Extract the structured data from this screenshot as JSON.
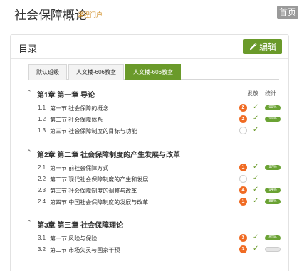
{
  "header": {
    "title": "社会保障概论",
    "portal_link": "课程门户",
    "home_label": "首页"
  },
  "card": {
    "title": "目录",
    "edit_label": "编辑"
  },
  "tabs": [
    {
      "label": "默认班级",
      "active": false
    },
    {
      "label": "人文楼-606教室",
      "active": false
    },
    {
      "label": "人文楼-606教室",
      "active": true
    }
  ],
  "columns": {
    "publish": "发放",
    "stats": "统计"
  },
  "chapters": [
    {
      "title": "第1章 第一章 导论",
      "lessons": [
        {
          "num": "1.1",
          "name": "第一节 社会保障的概念",
          "count": "2",
          "progress": "99%"
        },
        {
          "num": "1.2",
          "name": "第二节 社会保障体系",
          "count": "2",
          "progress": "99%"
        },
        {
          "num": "1.3",
          "name": "第三节 社会保障制度的目标与功能",
          "count": "",
          "progress": ""
        }
      ]
    },
    {
      "title": "第2章 第二章 社会保障制度的产生发展与改革",
      "lessons": [
        {
          "num": "2.1",
          "name": "第一节 前社会保障方式",
          "count": "1",
          "progress": "97%"
        },
        {
          "num": "2.2",
          "name": "第二节 现代社会保障制度的产生和发展",
          "count": "",
          "progress": ""
        },
        {
          "num": "2.3",
          "name": "第三节 社会保障制度的调整与改革",
          "count": "4",
          "progress": "94%"
        },
        {
          "num": "2.4",
          "name": "第四节 中国社会保障制度的发展与改革",
          "count": "1",
          "progress": "88%"
        }
      ]
    },
    {
      "title": "第3章 第三章 社会保障理论",
      "lessons": [
        {
          "num": "3.1",
          "name": "第一节 风险与保险",
          "count": "3",
          "progress": "80%"
        },
        {
          "num": "3.2",
          "name": "第二节 市场失灵与国家干预",
          "count": "3",
          "progress": ""
        }
      ]
    }
  ],
  "colors": {
    "accent": "#6a9a2a",
    "badge": "#f06b23",
    "portal": "#d08c23"
  },
  "icons": {
    "edit": "pencil-icon",
    "collapse": "chevron-up-icon",
    "done": "check-icon"
  }
}
